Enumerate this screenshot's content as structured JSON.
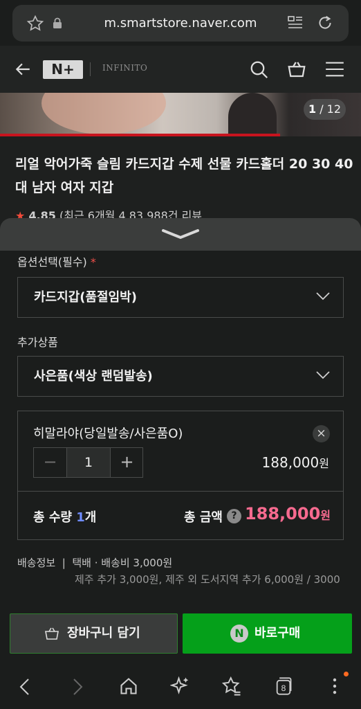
{
  "browser": {
    "url": "m.smartstore.naver.com"
  },
  "header": {
    "logo_text": "N+",
    "brand": "INFINITO"
  },
  "gallery": {
    "current": "1",
    "total": "/ 12",
    "progress": 0.776
  },
  "product": {
    "title": "리얼 악어가죽 슬림 카드지갑 수제 선물 카드홀더 20 30 40대 남자 여자 지갑",
    "rating": "4.85",
    "rating_recent": "(최근 6개월 4.83",
    "reviews": "988건 리뷰"
  },
  "options": {
    "label": "옵션선택(필수)",
    "required_mark": "*",
    "selected": "카드지갑(품절임박)"
  },
  "addon": {
    "label": "추가상품",
    "selected": "사은품(색상 랜덤발송)"
  },
  "item": {
    "name": "히말라야(당일발송/사은품O)",
    "close": "×",
    "minus": "−",
    "quantity": "1",
    "plus": "+",
    "price": "188,000",
    "currency": "원"
  },
  "total": {
    "qty_prefix": "총 수량 ",
    "qty_num": "1",
    "qty_suffix": "개",
    "amount_label": "총 금액",
    "help": "?",
    "price": "188,000",
    "currency": "원"
  },
  "shipping": {
    "label": "배송정보",
    "sep": "|",
    "method": "택배 · 배송비 3,000원",
    "extra": "제주 추가 3,000원, 제주 외 도서지역 추가 6,000원 / 3000"
  },
  "actions": {
    "cart": "장바구니 담기",
    "buy": "바로구매",
    "npay": "N"
  },
  "colors": {
    "accent_green": "#05a01a",
    "price_pink": "#f66a8f",
    "star_red": "#f04a3a"
  }
}
